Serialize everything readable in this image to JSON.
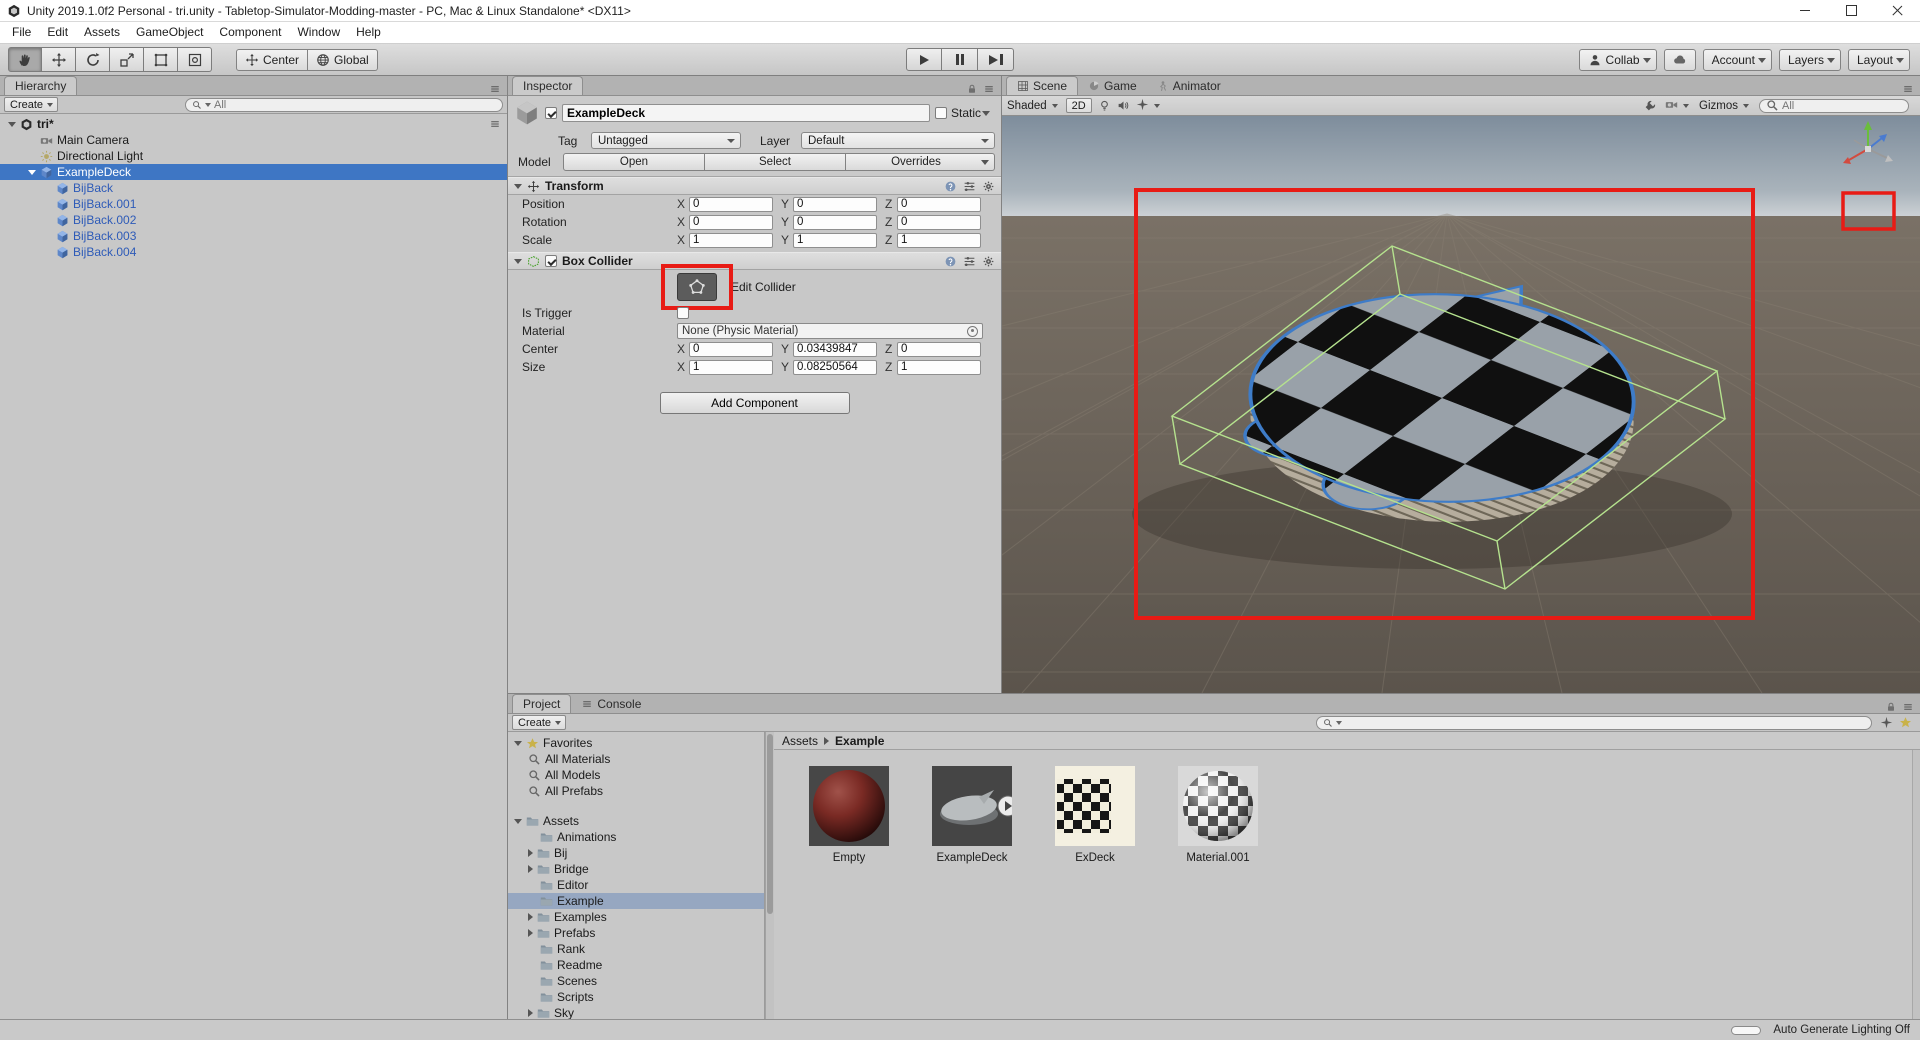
{
  "window": {
    "title": "Unity 2019.1.0f2 Personal - tri.unity - Tabletop-Simulator-Modding-master - PC, Mac & Linux Standalone* <DX11>"
  },
  "menubar": {
    "items": [
      "File",
      "Edit",
      "Assets",
      "GameObject",
      "Component",
      "Window",
      "Help"
    ]
  },
  "toolbar": {
    "pivot_label": "Center",
    "space_label": "Global",
    "collab_label": "Collab",
    "account_label": "Account",
    "layers_label": "Layers",
    "layout_label": "Layout"
  },
  "axis": [
    "X",
    "Y",
    "Z"
  ],
  "hierarchy": {
    "tab_label": "Hierarchy",
    "create_label": "Create",
    "search_placeholder": "All",
    "scene_name": "tri*",
    "items": [
      {
        "label": "Main Camera"
      },
      {
        "label": "Directional Light"
      },
      {
        "label": "ExampleDeck"
      },
      {
        "label": "BijBack"
      },
      {
        "label": "BijBack.001"
      },
      {
        "label": "BijBack.002"
      },
      {
        "label": "BijBack.003"
      },
      {
        "label": "BijBack.004"
      }
    ]
  },
  "inspector": {
    "tab_label": "Inspector",
    "header": {
      "name": "ExampleDeck",
      "static_label": "Static",
      "tag_label": "Tag",
      "tag_value": "Untagged",
      "layer_label": "Layer",
      "layer_value": "Default",
      "model_label": "Model",
      "open_label": "Open",
      "select_label": "Select",
      "overrides_label": "Overrides"
    },
    "transform": {
      "title": "Transform",
      "position_label": "Position",
      "rotation_label": "Rotation",
      "scale_label": "Scale",
      "position": {
        "x": "0",
        "y": "0",
        "z": "0"
      },
      "rotation": {
        "x": "0",
        "y": "0",
        "z": "0"
      },
      "scale": {
        "x": "1",
        "y": "1",
        "z": "1"
      }
    },
    "box_collider": {
      "title": "Box Collider",
      "edit_collider_label": "Edit Collider",
      "is_trigger_label": "Is Trigger",
      "material_label": "Material",
      "material_value": "None (Physic Material)",
      "center_label": "Center",
      "center": {
        "x": "0",
        "y": "0.03439847",
        "z": "0"
      },
      "size_label": "Size",
      "size": {
        "x": "1",
        "y": "0.08250564",
        "z": "1"
      }
    },
    "add_component_label": "Add Component"
  },
  "scene": {
    "tabs": [
      {
        "label": "Scene"
      },
      {
        "label": "Game"
      },
      {
        "label": "Animator"
      }
    ],
    "shading_mode": "Shaded",
    "toggle_2d_label": "2D",
    "gizmos_label": "Gizmos",
    "search_placeholder": "All"
  },
  "project": {
    "tabs": [
      {
        "label": "Project"
      },
      {
        "label": "Console"
      }
    ],
    "create_label": "Create",
    "favorites_label": "Favorites",
    "favorites": [
      {
        "label": "All Materials"
      },
      {
        "label": "All Models"
      },
      {
        "label": "All Prefabs"
      }
    ],
    "assets_label": "Assets",
    "folders": [
      {
        "label": "Animations"
      },
      {
        "label": "Bij"
      },
      {
        "label": "Bridge"
      },
      {
        "label": "Editor"
      },
      {
        "label": "Example"
      },
      {
        "label": "Examples"
      },
      {
        "label": "Prefabs"
      },
      {
        "label": "Rank"
      },
      {
        "label": "Readme"
      },
      {
        "label": "Scenes"
      },
      {
        "label": "Scripts"
      },
      {
        "label": "Sky"
      }
    ],
    "breadcrumb": {
      "root": "Assets",
      "current": "Example"
    },
    "assets": [
      {
        "label": "Empty"
      },
      {
        "label": "ExampleDeck"
      },
      {
        "label": "ExDeck"
      },
      {
        "label": "Material.001"
      }
    ]
  },
  "statusbar": {
    "lighting_label": "Auto Generate Lighting Off"
  },
  "colors": {
    "annotation_red": "#e81b15",
    "selection_blue": "#3e76c4",
    "prefab_text_blue": "#2e5bb8",
    "collider_green": "#b5e28e",
    "checker_light": "#99a1a9",
    "checker_dark": "#101010"
  }
}
